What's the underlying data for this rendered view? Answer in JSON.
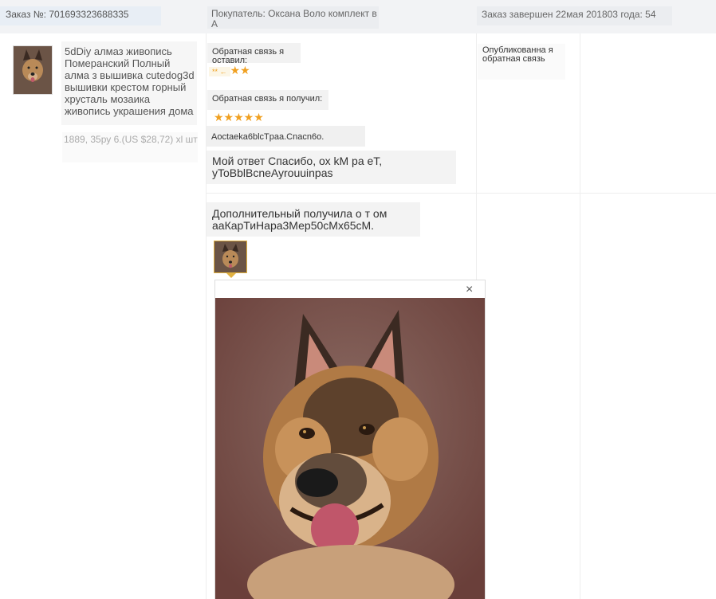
{
  "header": {
    "order_number": "Заказ №: 701693323688335",
    "buyer": "Покупатель: Оксана Воло комплект в А",
    "status": "Заказ завершен 22мая 201803 года: 54"
  },
  "product": {
    "title": "5dDiy алмаз живопись Померанский Полный алма з вышивка cutedog3d вышивки крестом горный хрусталь мозаика живопись украшения дома",
    "price": "1889, 35ру 6.(US $28,72) xl шт"
  },
  "feedback": {
    "left_label": "Обратная связь я оставил:",
    "left_stars_text": "** ←",
    "left_stars": "★★",
    "received_label": "Обратная связь я получил:",
    "received_stars": "★★★★★",
    "thanks_text": "Aoctaeka6blcTpaa.Cnacn6o.",
    "my_reply": "Мой ответ Спасибо, ох kМ ра еТ, уToBblBcneAyrouuinpas",
    "additional": "Дополнительный получила о т ом ааКарТиНара3Мер50сМх65сМ.",
    "published": "Опубликованна я обратная связь"
  },
  "popup": {
    "close_symbol": "×"
  },
  "colors": {
    "star": "#f0a020",
    "thumb_border": "#e0b040"
  }
}
